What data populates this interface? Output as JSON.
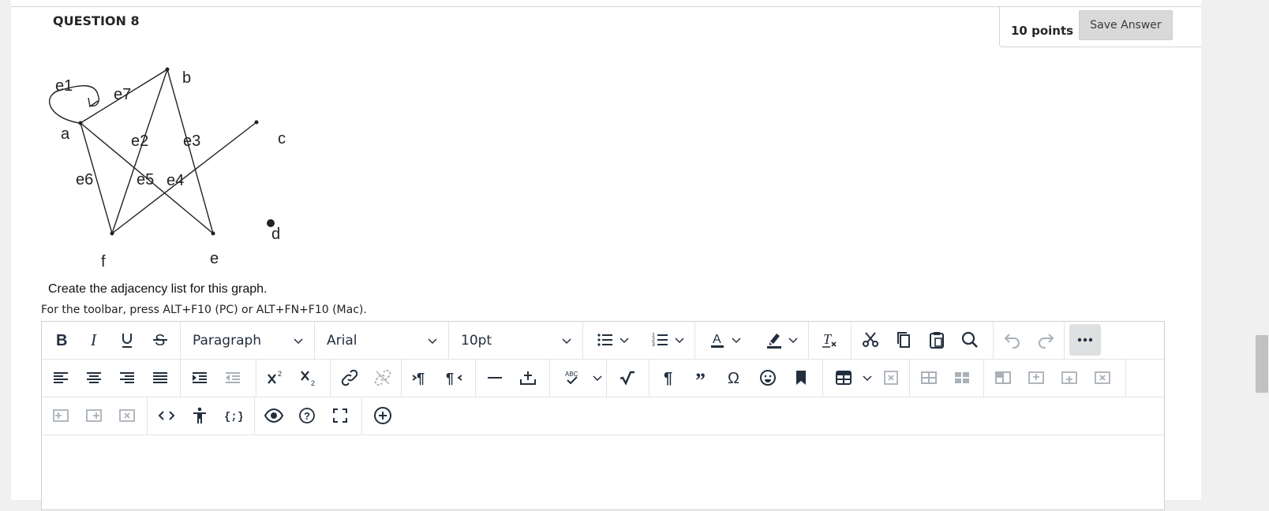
{
  "question": {
    "title": "QUESTION 8",
    "points": "10 points",
    "save_label": "Save Answer",
    "prompt": "Create the adjacency list for this graph.",
    "toolbar_hint": "For the toolbar, press ALT+F10 (PC) or ALT+FN+F10 (Mac).",
    "graph": {
      "vertex_labels": [
        "a",
        "b",
        "c",
        "d",
        "e",
        "f"
      ],
      "edge_labels": [
        "e1",
        "e2",
        "e3",
        "e4",
        "e5",
        "e6",
        "e7"
      ]
    }
  },
  "editor": {
    "block_format": "Paragraph",
    "font_family": "Arial",
    "font_size": "10pt"
  }
}
